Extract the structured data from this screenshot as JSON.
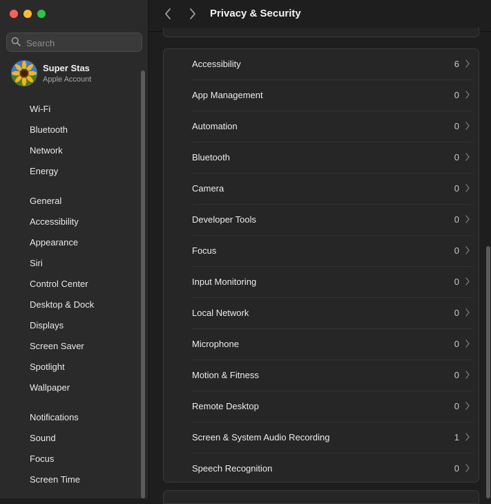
{
  "window": {
    "title": "Privacy & Security",
    "colors": {
      "close": "#ff5f57",
      "minimize": "#febc2e",
      "zoom": "#28c840"
    }
  },
  "sidebar": {
    "search": {
      "placeholder": "Search",
      "value": ""
    },
    "account": {
      "name": "Super Stas",
      "subtitle": "Apple Account"
    },
    "groups": [
      [
        "Wi-Fi",
        "Bluetooth",
        "Network",
        "Energy"
      ],
      [
        "General",
        "Accessibility",
        "Appearance",
        "Siri",
        "Control Center",
        "Desktop & Dock",
        "Displays",
        "Screen Saver",
        "Spotlight",
        "Wallpaper"
      ],
      [
        "Notifications",
        "Sound",
        "Focus",
        "Screen Time"
      ]
    ]
  },
  "main": {
    "rows": [
      {
        "label": "Accessibility",
        "count": "6"
      },
      {
        "label": "App Management",
        "count": "0"
      },
      {
        "label": "Automation",
        "count": "0"
      },
      {
        "label": "Bluetooth",
        "count": "0"
      },
      {
        "label": "Camera",
        "count": "0"
      },
      {
        "label": "Developer Tools",
        "count": "0"
      },
      {
        "label": "Focus",
        "count": "0"
      },
      {
        "label": "Input Monitoring",
        "count": "0"
      },
      {
        "label": "Local Network",
        "count": "0"
      },
      {
        "label": "Microphone",
        "count": "0"
      },
      {
        "label": "Motion & Fitness",
        "count": "0"
      },
      {
        "label": "Remote Desktop",
        "count": "0"
      },
      {
        "label": "Screen & System Audio Recording",
        "count": "1"
      },
      {
        "label": "Speech Recognition",
        "count": "0"
      }
    ]
  }
}
